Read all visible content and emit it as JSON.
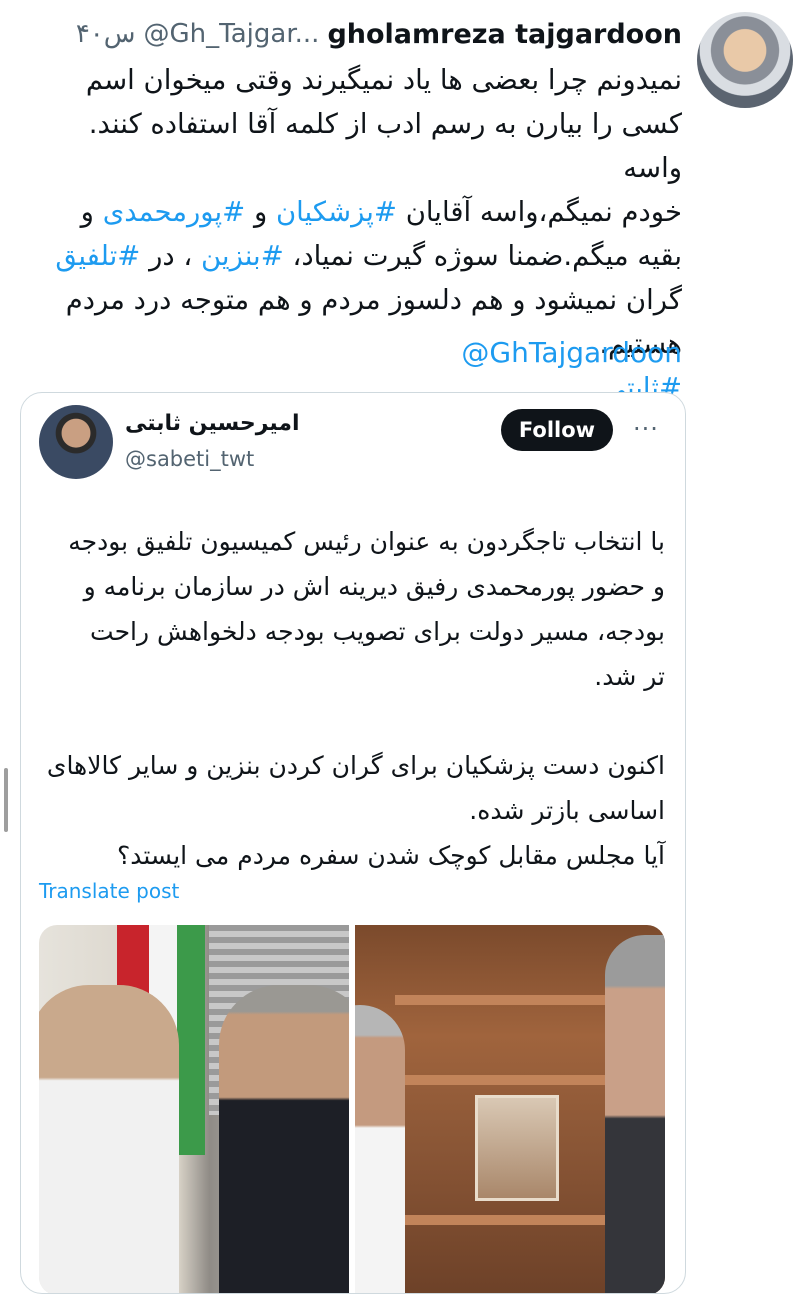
{
  "post": {
    "author_name": "gholamreza tajgardoon",
    "author_handle": "@Gh_Tajgar...",
    "time": "۴۰س",
    "body_lines": [
      "نمیدونم چرا بعضی ها یاد نمیگیرند وقتی میخوان اسم",
      "کسی را بیارن به رسم ادب از کلمه آقا استفاده کنند. واسه",
      "خودم نمیگم،واسه آقایان ",
      "#پزشکیان",
      " و ",
      "#پورمحمدی",
      " و",
      "بقیه میگم.ضمنا سوژه گیرت نمیاد، ",
      "#بنزین",
      " ، در ",
      "#تلفیق",
      "گران نمیشود و هم دلسوز مردم و هم متوجه درد مردم",
      "هستیم.",
      "#ثابتی"
    ],
    "mention": "@GhTajgardoon"
  },
  "quote": {
    "name": "امیرحسین ثابتی",
    "handle": "@sabeti_twt",
    "follow_label": "Follow",
    "more_icon": "more-icon",
    "body_lines": [
      "با انتخاب تاجگردون به عنوان رئیس کمیسیون تلفیق بودجه",
      "و حضور پورمحمدی رفیق دیرینه اش در سازمان برنامه و",
      "بودجه، مسیر دولت برای تصویب بودجه دلخواهش راحت",
      "تر شد.",
      "اکنون دست پزشکیان برای گران کردن بنزین و سایر کالاهای",
      "اساسی بازتر شده.",
      "آیا مجلس مقابل کوچک شدن سفره مردم می ایستد؟"
    ],
    "translate_label": "Translate post",
    "more_dots": "···"
  },
  "colors": {
    "link": "#1d9bf0",
    "text": "#0f1419",
    "secondary": "#536471",
    "border": "#cfd9de"
  }
}
